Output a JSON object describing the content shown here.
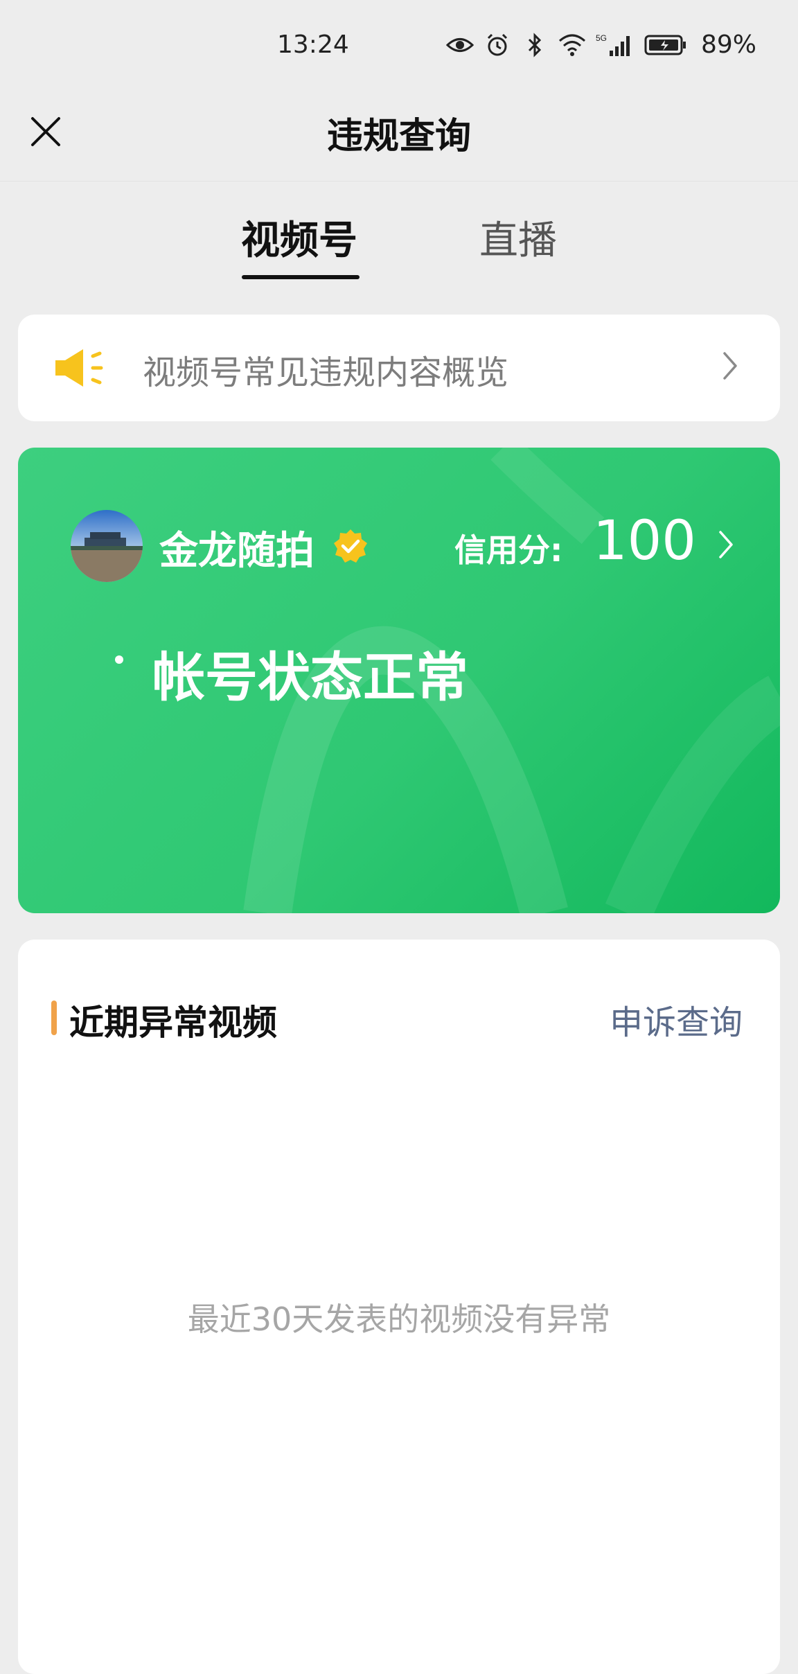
{
  "status_bar": {
    "time": "13:24",
    "battery": "89%",
    "icons": [
      "eye-icon",
      "alarm-icon",
      "bluetooth-icon",
      "wifi-icon",
      "signal-5g-icon",
      "battery-icon"
    ]
  },
  "header": {
    "title": "违规查询",
    "close_icon": "close-icon"
  },
  "tabs": [
    {
      "label": "视频号",
      "active": true
    },
    {
      "label": "直播",
      "active": false
    }
  ],
  "notice": {
    "icon": "speaker-icon",
    "text": "视频号常见违规内容概览",
    "accent": "#f7c31d"
  },
  "account": {
    "name": "金龙随拍",
    "verified": true,
    "credit_label": "信用分:",
    "credit_value": "100",
    "state": "帐号状态正常",
    "card_color": "#2fc873"
  },
  "recent": {
    "title": "近期异常视频",
    "appeal_link": "申诉查询",
    "empty_message": "最近30天发表的视频没有异常",
    "accent": "#f0a24a"
  }
}
